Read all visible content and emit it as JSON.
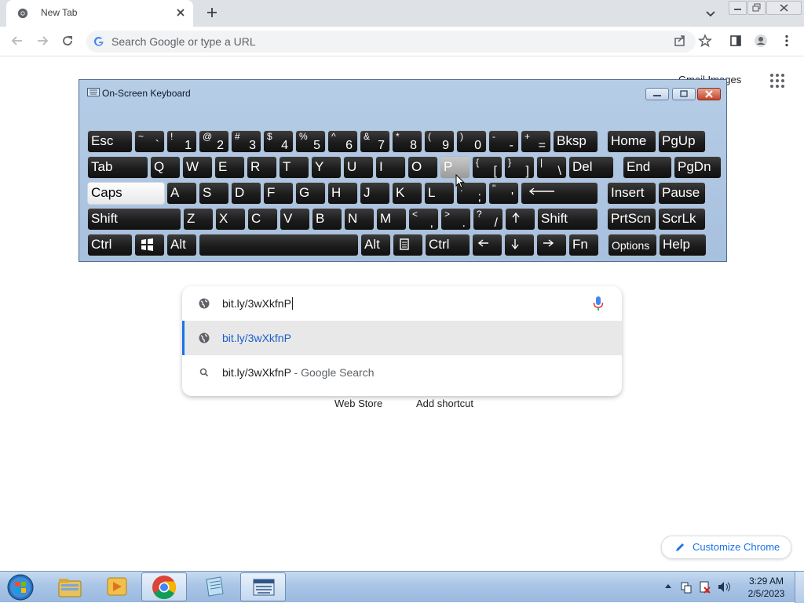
{
  "browser": {
    "tab_title": "New Tab",
    "omnibox_placeholder": "Search Google or type a URL"
  },
  "page": {
    "top_link": "Gmail  Images",
    "shortcuts": [
      "Web Store",
      "Add shortcut"
    ],
    "customize_label": "Customize Chrome"
  },
  "suggestions": {
    "input_value": "bit.ly/3wXkfnP",
    "items": [
      {
        "text": "bit.ly/3wXkfnP",
        "suffix": "",
        "icon": "globe-icon"
      },
      {
        "text": "bit.ly/3wXkfnP",
        "suffix": " - Google Search",
        "icon": "search-icon"
      }
    ]
  },
  "osk": {
    "title": "On-Screen Keyboard",
    "rows": [
      [
        {
          "main": "Esc"
        },
        {
          "main": "`",
          "shift": "~"
        },
        {
          "main": "1",
          "shift": "!"
        },
        {
          "main": "2",
          "shift": "@"
        },
        {
          "main": "3",
          "shift": "#"
        },
        {
          "main": "4",
          "shift": "$"
        },
        {
          "main": "5",
          "shift": "%"
        },
        {
          "main": "6",
          "shift": "^"
        },
        {
          "main": "7",
          "shift": "&"
        },
        {
          "main": "8",
          "shift": "*"
        },
        {
          "main": "9",
          "shift": "("
        },
        {
          "main": "0",
          "shift": ")"
        },
        {
          "main": "-",
          "shift": "-"
        },
        {
          "main": "=",
          "shift": "+"
        },
        {
          "main": "Bksp"
        },
        {
          "main": "Home"
        },
        {
          "main": "PgUp"
        }
      ],
      [
        {
          "main": "Tab"
        },
        {
          "main": "Q"
        },
        {
          "main": "W"
        },
        {
          "main": "E"
        },
        {
          "main": "R"
        },
        {
          "main": "T"
        },
        {
          "main": "Y"
        },
        {
          "main": "U"
        },
        {
          "main": "I"
        },
        {
          "main": "O"
        },
        {
          "main": "P"
        },
        {
          "main": "[",
          "shift": "{"
        },
        {
          "main": "]",
          "shift": "}"
        },
        {
          "main": "\\",
          "shift": "|"
        },
        {
          "main": "Del"
        },
        {
          "main": "End"
        },
        {
          "main": "PgDn"
        }
      ],
      [
        {
          "main": "Caps"
        },
        {
          "main": "A"
        },
        {
          "main": "S"
        },
        {
          "main": "D"
        },
        {
          "main": "F"
        },
        {
          "main": "G"
        },
        {
          "main": "H"
        },
        {
          "main": "J"
        },
        {
          "main": "K"
        },
        {
          "main": "L"
        },
        {
          "main": ";",
          "shift": ":"
        },
        {
          "main": "'",
          "shift": "\""
        },
        {
          "main": "",
          "icon": "enter-arrow-icon"
        },
        {
          "main": "Insert"
        },
        {
          "main": "Pause"
        }
      ],
      [
        {
          "main": "Shift"
        },
        {
          "main": "Z"
        },
        {
          "main": "X"
        },
        {
          "main": "C"
        },
        {
          "main": "V"
        },
        {
          "main": "B"
        },
        {
          "main": "N"
        },
        {
          "main": "M"
        },
        {
          "main": ",",
          "shift": "<"
        },
        {
          "main": ".",
          "shift": ">"
        },
        {
          "main": "/",
          "shift": "?"
        },
        {
          "main": "",
          "icon": "arrow-up-icon"
        },
        {
          "main": "Shift"
        },
        {
          "main": "PrtScn"
        },
        {
          "main": "ScrLk"
        }
      ],
      [
        {
          "main": "Ctrl"
        },
        {
          "main": "",
          "icon": "windows-logo-icon"
        },
        {
          "main": "Alt"
        },
        {
          "main": "",
          "icon": "spacebar"
        },
        {
          "main": "Alt"
        },
        {
          "main": "",
          "icon": "menu-key-icon"
        },
        {
          "main": "Ctrl"
        },
        {
          "main": "",
          "icon": "arrow-left-icon"
        },
        {
          "main": "",
          "icon": "arrow-down-icon"
        },
        {
          "main": "",
          "icon": "arrow-right-icon"
        },
        {
          "main": "Fn"
        },
        {
          "main": "Options"
        },
        {
          "main": "Help"
        }
      ]
    ]
  },
  "taskbar": {
    "pinned": [
      "start-orb-icon",
      "file-explorer-icon",
      "media-player-icon",
      "chrome-icon",
      "notepad-icon",
      "on-screen-keyboard-icon"
    ],
    "time": "3:29 AM",
    "date": "2/5/2023"
  }
}
